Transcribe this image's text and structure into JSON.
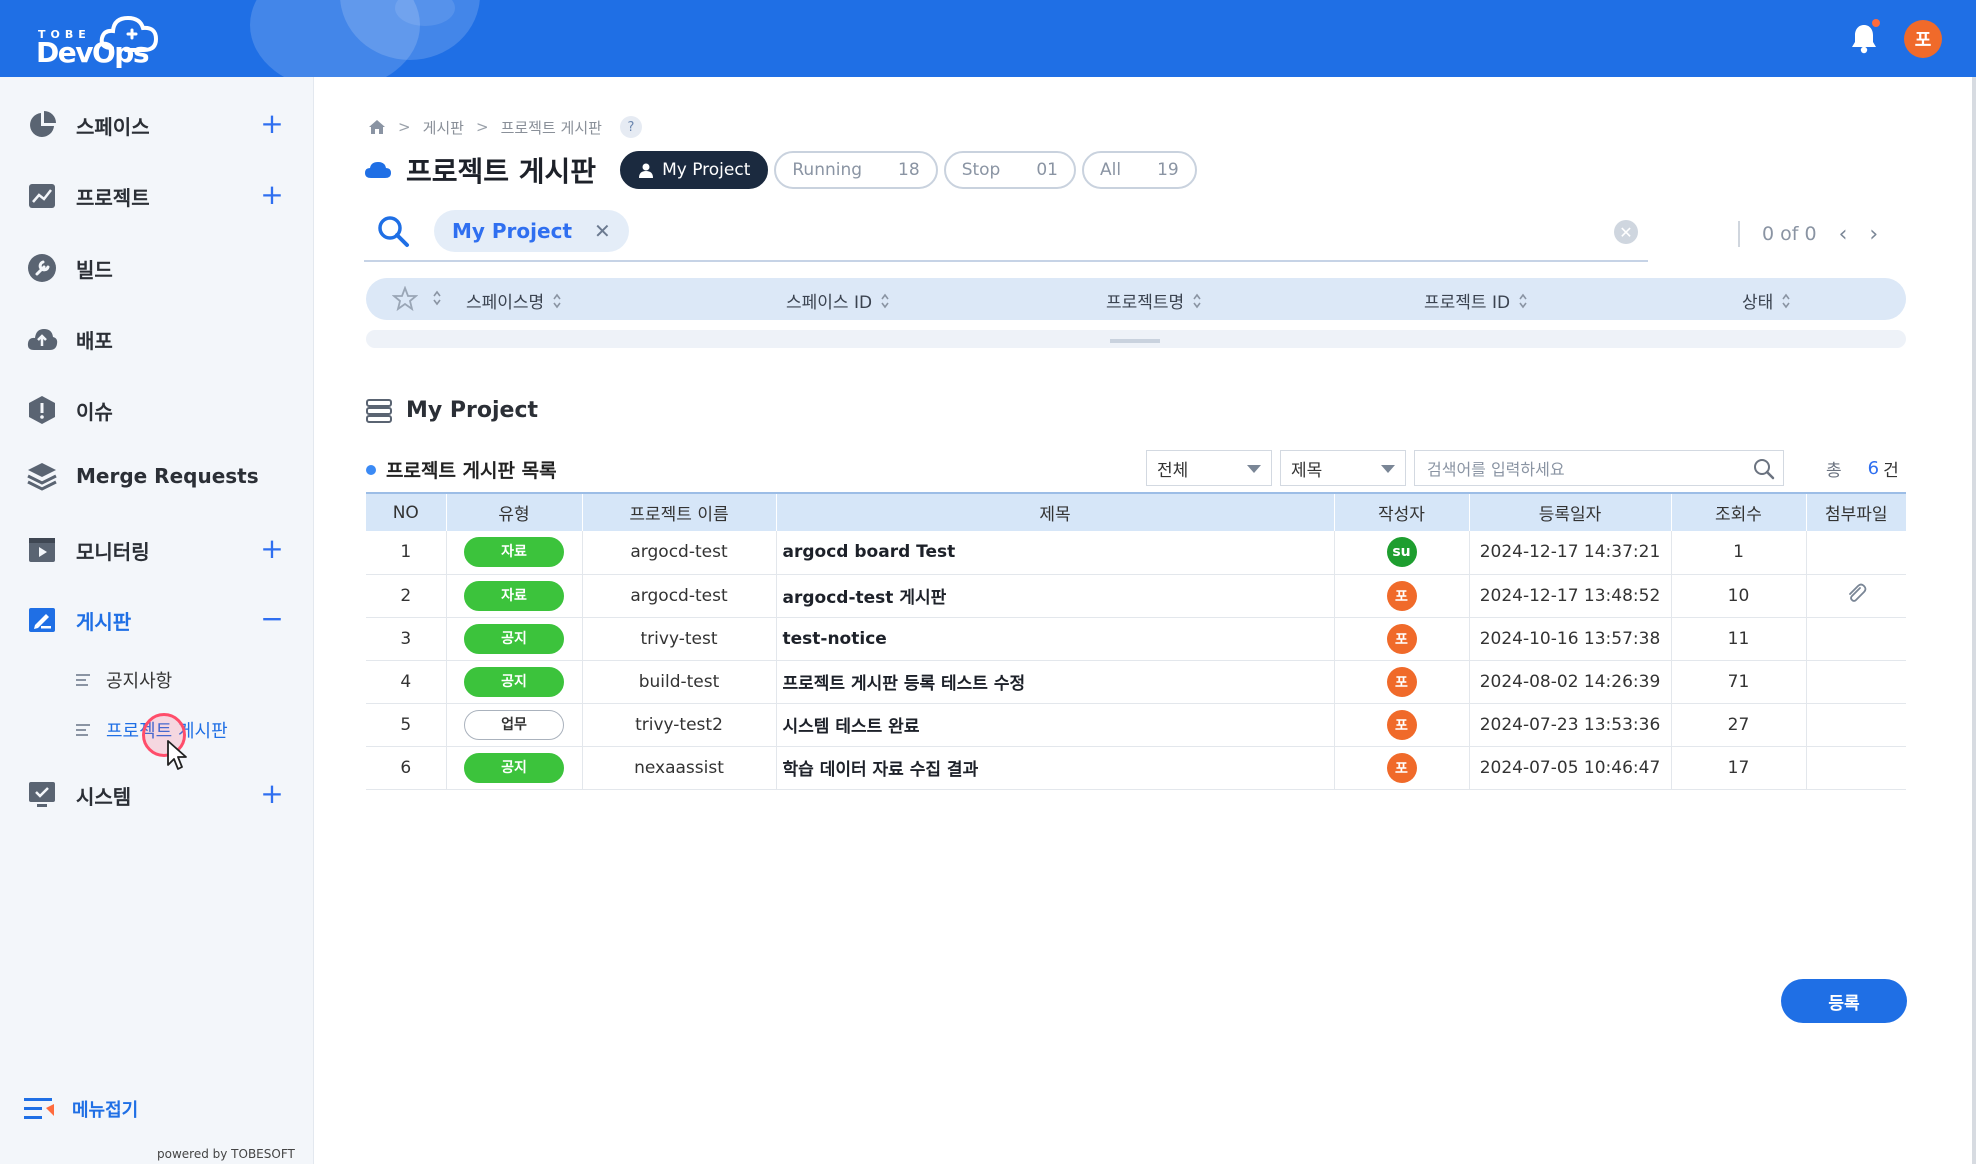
{
  "header": {
    "logo_top": "TOBE",
    "logo_main": "DevOps",
    "user_initial": "포"
  },
  "sidebar": {
    "items": [
      {
        "label": "스페이스",
        "plus": "+"
      },
      {
        "label": "프로젝트",
        "plus": "+"
      },
      {
        "label": "빌드"
      },
      {
        "label": "배포"
      },
      {
        "label": "이슈"
      },
      {
        "label": "Merge Requests"
      },
      {
        "label": "모니터링",
        "plus": "+"
      },
      {
        "label": "게시판",
        "minus": "−"
      },
      {
        "label": "시스템",
        "plus": "+"
      }
    ],
    "sub_items": [
      {
        "label": "공지사항"
      },
      {
        "label": "프로젝트 게시판"
      }
    ],
    "menu_fold": "메뉴접기",
    "powered": "powered by TOBESOFT"
  },
  "breadcrumb": {
    "level1": "게시판",
    "level2": "프로젝트 게시판",
    "sep": ">",
    "help": "?"
  },
  "page": {
    "title": "프로젝트 게시판",
    "filters": {
      "my_project": "My Project",
      "running_label": "Running",
      "running_count": "18",
      "stop_label": "Stop",
      "stop_count": "01",
      "all_label": "All",
      "all_count": "19"
    }
  },
  "search": {
    "chip": "My Project",
    "chip_close": "✕",
    "clear": "✕",
    "pager_text": "0 of 0",
    "prev": "‹",
    "next": "›"
  },
  "grid": {
    "columns": [
      "스페이스명",
      "스페이스 ID",
      "프로젝트명",
      "프로젝트 ID",
      "상태"
    ]
  },
  "section": {
    "title": "My Project"
  },
  "list": {
    "title": "프로젝트 게시판 목록",
    "filter_scope": "전체",
    "filter_field": "제목",
    "search_placeholder": "검색어를 입력하세요",
    "total_label": "총",
    "total_count": "6",
    "total_unit": "건",
    "columns": [
      "NO",
      "유형",
      "프로젝트 이름",
      "제목",
      "작성자",
      "등록일자",
      "조회수",
      "첨부파일"
    ],
    "rows": [
      {
        "no": "1",
        "type": "자료",
        "type_style": "green",
        "project": "argocd-test",
        "title": "argocd board Test",
        "author": "su",
        "author_color": "#1e9e2f",
        "date": "2024-12-17 14:37:21",
        "views": "1",
        "attachment": false
      },
      {
        "no": "2",
        "type": "자료",
        "type_style": "green",
        "project": "argocd-test",
        "title": "argocd-test 게시판",
        "author": "포",
        "author_color": "#f06a2a",
        "date": "2024-12-17 13:48:52",
        "views": "10",
        "attachment": true
      },
      {
        "no": "3",
        "type": "공지",
        "type_style": "green",
        "project": "trivy-test",
        "title": "test-notice",
        "author": "포",
        "author_color": "#f06a2a",
        "date": "2024-10-16 13:57:38",
        "views": "11",
        "attachment": false
      },
      {
        "no": "4",
        "type": "공지",
        "type_style": "green",
        "project": "build-test",
        "title": "프로젝트 게시판 등록 테스트 수정",
        "author": "포",
        "author_color": "#f06a2a",
        "date": "2024-08-02 14:26:39",
        "views": "71",
        "attachment": false
      },
      {
        "no": "5",
        "type": "업무",
        "type_style": "outline",
        "project": "trivy-test2",
        "title": "시스템 테스트 완료",
        "author": "포",
        "author_color": "#f06a2a",
        "date": "2024-07-23 13:53:36",
        "views": "27",
        "attachment": false
      },
      {
        "no": "6",
        "type": "공지",
        "type_style": "green",
        "project": "nexaassist",
        "title": "학습 데이터 자료 수집 결과",
        "author": "포",
        "author_color": "#f06a2a",
        "date": "2024-07-05 10:46:47",
        "views": "17",
        "attachment": false
      }
    ]
  },
  "actions": {
    "register": "등록"
  },
  "colors": {
    "primary": "#1f6fe5",
    "badge_green": "#3cc33c",
    "avatar_orange": "#f06a2a",
    "avatar_green": "#1e9e2f",
    "dark_pill": "#1b2a3f"
  }
}
